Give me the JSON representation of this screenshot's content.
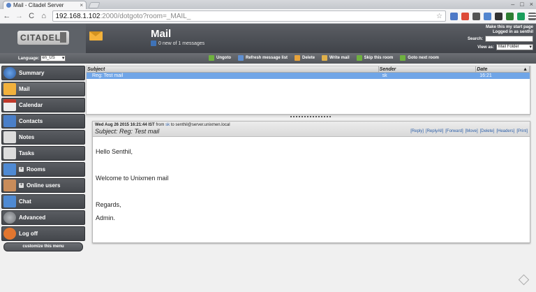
{
  "browser": {
    "tab_title": "Mail - Citadel Server",
    "tab_close": "×",
    "url_host": "192.168.1.102",
    "url_path": ":2000/dotgoto?room=_MAIL_",
    "back": "←",
    "forward": "→",
    "reload": "C",
    "home": "⌂",
    "star": "☆",
    "window_controls": [
      "–",
      "□",
      "×"
    ]
  },
  "header": {
    "logo": "CITADEL",
    "room_title": "Mail",
    "room_count": "0 new of 1 messages",
    "start_page_link": "Make this my start page",
    "logged_in": "Logged in as senthil",
    "search_label": "Search:",
    "search_value": "",
    "view_as_label": "View as:",
    "view_as_value": "Mail Folder"
  },
  "toolbar": {
    "language_label": "Language:",
    "language_value": "en_US",
    "actions": [
      {
        "label": "Ungoto",
        "color": "#6fb13f"
      },
      {
        "label": "Refresh message list",
        "color": "#5f8fd0"
      },
      {
        "label": "Delete",
        "color": "#e8a33a"
      },
      {
        "label": "Write mail",
        "color": "#e0b04a"
      },
      {
        "label": "Skip this room",
        "color": "#6fb13f"
      },
      {
        "label": "Goto next room",
        "color": "#6fb13f"
      }
    ]
  },
  "sidebar": {
    "items": [
      {
        "label": "Summary",
        "icon": "globe-icon",
        "color": "#3a6fc0"
      },
      {
        "label": "Mail",
        "icon": "envelope-icon",
        "color": "#f2b13c"
      },
      {
        "label": "Calendar",
        "icon": "calendar-icon",
        "color": "#e2e2e2"
      },
      {
        "label": "Contacts",
        "icon": "contacts-icon",
        "color": "#4a7fc9"
      },
      {
        "label": "Notes",
        "icon": "notes-icon",
        "color": "#d9d9d9"
      },
      {
        "label": "Tasks",
        "icon": "tasks-icon",
        "color": "#d9d9d9"
      },
      {
        "label": "Rooms",
        "icon": "folder-icon",
        "color": "#4f8ad3"
      },
      {
        "label": "Online users",
        "icon": "user-icon",
        "color": "#c98c5a"
      },
      {
        "label": "Chat",
        "icon": "chat-icon",
        "color": "#4f8ad3"
      },
      {
        "label": "Advanced",
        "icon": "gear-icon",
        "color": "#8a8d91"
      },
      {
        "label": "Log off",
        "icon": "power-icon",
        "color": "#e2762f"
      }
    ],
    "plus": "+",
    "customize_label": "customize this menu"
  },
  "message_list": {
    "columns": [
      "Subject",
      "Sender",
      "Date"
    ],
    "sort_indicator": "▲",
    "rows": [
      {
        "subject": "Reg: Test mail",
        "sender": "sk",
        "date": "16:21"
      }
    ]
  },
  "preview": {
    "date": "Wed Aug 26 2015 16:21:44 IST",
    "from_label": "from",
    "from": "sk",
    "to_label": "to",
    "to": "senthil@server.unixmen.local",
    "subject_label": "Subject:",
    "subject": "Reg: Test mail",
    "actions": [
      "[Reply]",
      "[ReplyAll]",
      "[Forward]",
      "[Move]",
      "[Delete]",
      "[Headers]",
      "[Print]"
    ],
    "body_lines": [
      "Hello Senthil,",
      "",
      "Welcome to Unixmen mail",
      "",
      "",
      "Regards,",
      "Admin."
    ]
  }
}
